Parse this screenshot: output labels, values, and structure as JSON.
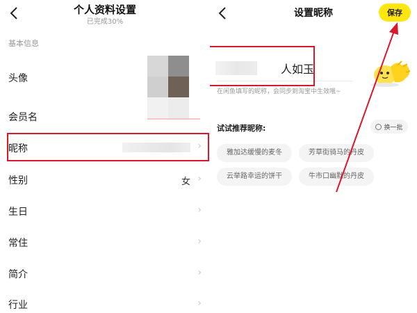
{
  "left": {
    "title": "个人资料设置",
    "subtitle": "已完成30%",
    "back_icon": "back-arrow-icon",
    "section_label": "基本信息",
    "rows": [
      {
        "label": "头像",
        "value": ""
      },
      {
        "label": "会员名",
        "value": ""
      },
      {
        "label": "昵称",
        "value": ""
      },
      {
        "label": "性别",
        "value": "女"
      },
      {
        "label": "生日",
        "value": ""
      },
      {
        "label": "常住",
        "value": ""
      },
      {
        "label": "简介",
        "value": ""
      },
      {
        "label": "行业",
        "value": ""
      }
    ],
    "chevron_icon": "chevron-right-icon"
  },
  "right": {
    "title": "设置昵称",
    "back_icon": "back-arrow-icon",
    "save_label": "保存",
    "nickname_value": "人如玉",
    "hint": "在闲鱼填写的昵称，会同步到淘宝中生效哦~",
    "suggest_title": "试试推荐昵称:",
    "refresh_label": "换一批",
    "suggestions": [
      "雅加达缓慢的麦冬",
      "芳草街骑马的丹皮",
      "云举路幸运的饼干",
      "牛市口幽默的丹皮"
    ]
  },
  "colors": {
    "accent_yellow": "#ffe60f",
    "highlight_red": "#d9182b",
    "hint_gray": "#999999",
    "chip_bg": "#f4f4f4"
  }
}
